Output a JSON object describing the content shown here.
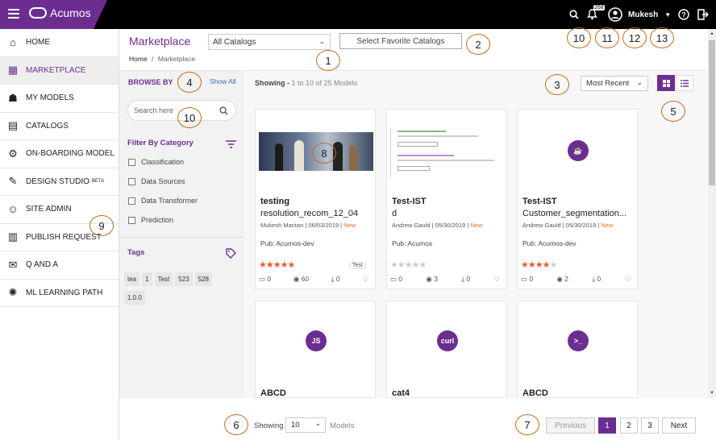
{
  "app": {
    "name": "Acumos",
    "accent": "#6c2d91",
    "new_color": "#f06b22"
  },
  "topbar": {
    "notifications_count": "268",
    "user": "Mukesh"
  },
  "sidebar": {
    "items": [
      {
        "label": "HOME",
        "icon": "home-icon"
      },
      {
        "label": "MARKETPLACE",
        "icon": "store-icon",
        "active": true
      },
      {
        "label": "MY MODELS",
        "icon": "robot-icon"
      },
      {
        "label": "CATALOGS",
        "icon": "catalog-icon"
      },
      {
        "label": "ON-BOARDING MODEL",
        "icon": "onboard-icon"
      },
      {
        "label": "DESIGN STUDIO",
        "sup": "BETA",
        "icon": "design-icon"
      },
      {
        "label": "SITE ADMIN",
        "icon": "admin-icon"
      },
      {
        "label": "PUBLISH REQUEST",
        "icon": "publish-icon"
      },
      {
        "label": "Q AND A",
        "icon": "qa-icon"
      },
      {
        "label": "ML LEARNING PATH",
        "icon": "brain-icon"
      }
    ]
  },
  "header": {
    "title": "Marketplace",
    "catalog_select": "All Catalogs",
    "favorite_button": "Select Favorite Catalogs",
    "breadcrumb_home": "Home",
    "breadcrumb_sep": "/",
    "breadcrumb_current": "Marketplace"
  },
  "filter": {
    "browse_by": "BROWSE BY",
    "show_all": "Show All",
    "search_placeholder": "Search here",
    "category_title": "Filter By Category",
    "categories": [
      "Classification",
      "Data Sources",
      "Data Transformer",
      "Prediction"
    ],
    "tags_title": "Tags",
    "tags": [
      "tea",
      "1",
      "Test",
      "523",
      "528",
      "1.0.0"
    ]
  },
  "main": {
    "showing_label": "Showing -",
    "showing_range": "1 to 10 of 25 Models",
    "sort": "Most Recent"
  },
  "cards": [
    {
      "title": "testing",
      "subtitle": "resolution_recom_12_04",
      "author": "Mukesh Mantan",
      "date": "06/03/2019",
      "badge": "New",
      "pub": "Pub: Acumos-dev",
      "rating": 5,
      "tag": "Test",
      "comments": "0",
      "views": "60",
      "downloads": "0"
    },
    {
      "title": "Test-IST",
      "subtitle": "d",
      "author": "Andrew Gauld",
      "date": "05/30/2019",
      "badge": "New",
      "pub": "Pub: Acumos",
      "rating": 0,
      "comments": "0",
      "views": "3",
      "downloads": "0"
    },
    {
      "title": "Test-IST",
      "subtitle": "Customer_segmentation...",
      "author": "Andrew Gauld",
      "date": "05/30/2019",
      "badge": "New",
      "pub": "Pub: Acumos-dev",
      "rating": 4,
      "comments": "0",
      "views": "2",
      "downloads": "0"
    },
    {
      "title": "ABCD",
      "icon_text": "JS"
    },
    {
      "title": "cat4",
      "icon_text": "curl"
    },
    {
      "title": "ABCD",
      "icon_text": ">_"
    }
  ],
  "pagination": {
    "showing": "Showing",
    "per_page": "10",
    "models": "Models",
    "previous": "Previous",
    "pages": [
      "1",
      "2",
      "3"
    ],
    "next": "Next"
  },
  "callouts": [
    "1",
    "2",
    "3",
    "4",
    "5",
    "6",
    "7",
    "8",
    "9",
    "10",
    "10",
    "11",
    "12",
    "13"
  ]
}
